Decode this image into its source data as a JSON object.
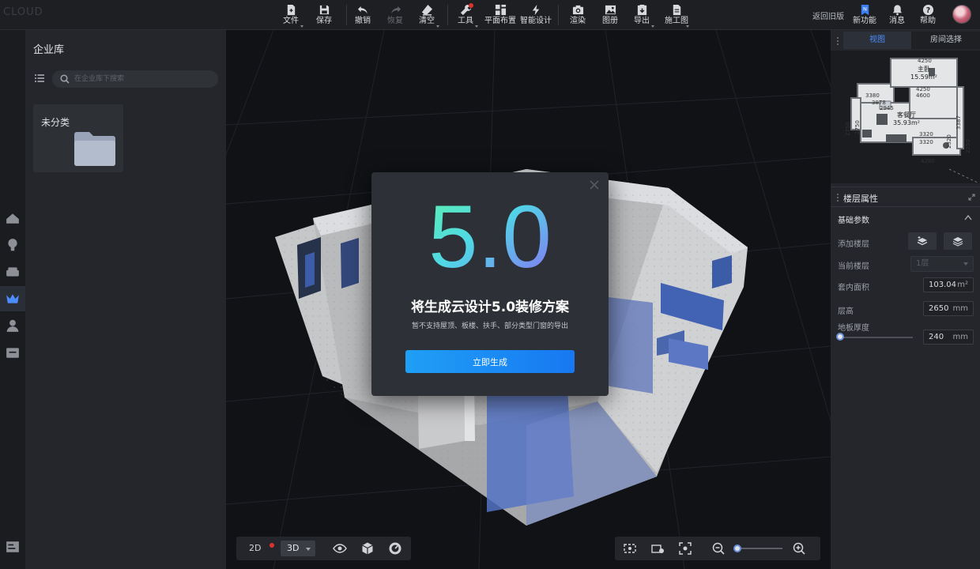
{
  "toolbar": {
    "file": "文件",
    "save": "保存",
    "undo": "撤销",
    "redo": "恢复",
    "clear": "清空",
    "tools": "工具",
    "floor_plan": "平面布置",
    "smart_design": "智能设计",
    "render": "渲染",
    "gallery": "图册",
    "export": "导出",
    "construction": "施工图",
    "old_version": "返回旧版",
    "new_feature": "新功能",
    "messages": "消息",
    "help": "帮助"
  },
  "library": {
    "title": "企业库",
    "search_placeholder": "在企业库下搜索",
    "folders": [
      {
        "name": "未分类",
        "icon": "folder-icon"
      }
    ]
  },
  "modal": {
    "version": "5.0",
    "title": "将生成云设计5.0装修方案",
    "subtitle": "暂不支持屋顶、板楼、扶手、部分类型门窗的导出",
    "confirm_label": "立即生成"
  },
  "view_controls": {
    "mode_2d": "2D",
    "mode_3d": "3D",
    "active_mode": "3D",
    "zoom_level": 0.05
  },
  "right_panel": {
    "tabs": [
      {
        "label": "视图",
        "active": true
      },
      {
        "label": "房间选择",
        "active": false
      }
    ],
    "minimap": {
      "rooms": [
        {
          "name": "主卧",
          "area": "15.59m²"
        },
        {
          "name": "客餐厅",
          "area": "35.93m²"
        }
      ],
      "dimensions": [
        "4250",
        "3380",
        "4250",
        "4600",
        "2945",
        "3878",
        "3320",
        "3320",
        "4280",
        "2750",
        "2750",
        "3387",
        "2250",
        "2320"
      ]
    },
    "floor_props": {
      "title": "楼层属性",
      "section": "基础参数",
      "add_floor_label": "添加楼层",
      "current_floor_label": "当前楼层",
      "current_floor_value": "1层",
      "indoor_area_label": "套内面积",
      "indoor_area_value": "103.04",
      "indoor_area_unit": "m²",
      "height_label": "层高",
      "height_value": "2650",
      "height_unit": "mm",
      "floor_thickness_label": "地板厚度",
      "floor_thickness_value": "240",
      "floor_thickness_unit": "mm"
    }
  },
  "colors": {
    "accent": "#1778f2",
    "active_tab": "#4d8cff",
    "notification": "#e0312d",
    "background": "#131519",
    "panel": "#24262b"
  }
}
